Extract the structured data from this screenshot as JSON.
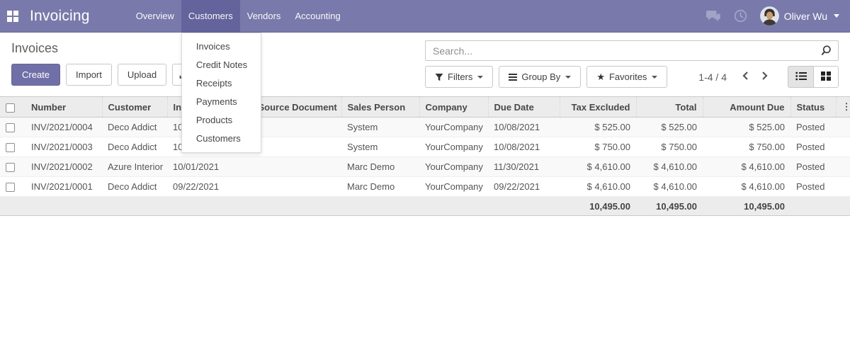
{
  "colors": {
    "navbar_bg": "#7a79ab",
    "navbar_active_bg": "#64639c",
    "primary_button_bg": "#716fa8",
    "table_header_bg": "#ececec"
  },
  "navbar": {
    "brand": "Invoicing",
    "items": [
      {
        "label": "Overview",
        "active": false
      },
      {
        "label": "Customers",
        "active": true
      },
      {
        "label": "Vendors",
        "active": false
      },
      {
        "label": "Accounting",
        "active": false
      }
    ],
    "user_name": "Oliver Wu"
  },
  "customers_dropdown": {
    "items": [
      "Invoices",
      "Credit Notes",
      "Receipts",
      "Payments",
      "Products",
      "Customers"
    ]
  },
  "control_panel": {
    "title": "Invoices",
    "create_label": "Create",
    "import_label": "Import",
    "upload_label": "Upload",
    "search_placeholder": "Search...",
    "filters_label": "Filters",
    "group_by_label": "Group By",
    "favorites_label": "Favorites",
    "pager_text": "1-4 / 4"
  },
  "table": {
    "headers": {
      "number": "Number",
      "customer": "Customer",
      "invoice_date": "Invoice Date",
      "source_document": "Source Document",
      "sales_person": "Sales Person",
      "company": "Company",
      "due_date": "Due Date",
      "tax_excluded": "Tax Excluded",
      "total": "Total",
      "amount_due": "Amount Due",
      "status": "Status"
    },
    "rows": [
      {
        "number": "INV/2021/0004",
        "customer": "Deco Addict",
        "invoice_date": "10/08/2021",
        "source_document": "",
        "sales_person": "System",
        "company": "YourCompany",
        "due_date": "10/08/2021",
        "tax_excluded": "$ 525.00",
        "total": "$ 525.00",
        "amount_due": "$ 525.00",
        "status": "Posted"
      },
      {
        "number": "INV/2021/0003",
        "customer": "Deco Addict",
        "invoice_date": "10/08/2021",
        "source_document": "",
        "sales_person": "System",
        "company": "YourCompany",
        "due_date": "10/08/2021",
        "tax_excluded": "$ 750.00",
        "total": "$ 750.00",
        "amount_due": "$ 750.00",
        "status": "Posted"
      },
      {
        "number": "INV/2021/0002",
        "customer": "Azure Interior",
        "invoice_date": "10/01/2021",
        "source_document": "",
        "sales_person": "Marc Demo",
        "company": "YourCompany",
        "due_date": "11/30/2021",
        "tax_excluded": "$ 4,610.00",
        "total": "$ 4,610.00",
        "amount_due": "$ 4,610.00",
        "status": "Posted"
      },
      {
        "number": "INV/2021/0001",
        "customer": "Deco Addict",
        "invoice_date": "09/22/2021",
        "source_document": "",
        "sales_person": "Marc Demo",
        "company": "YourCompany",
        "due_date": "09/22/2021",
        "tax_excluded": "$ 4,610.00",
        "total": "$ 4,610.00",
        "amount_due": "$ 4,610.00",
        "status": "Posted"
      }
    ],
    "footer": {
      "tax_excluded": "10,495.00",
      "total": "10,495.00",
      "amount_due": "10,495.00"
    }
  }
}
